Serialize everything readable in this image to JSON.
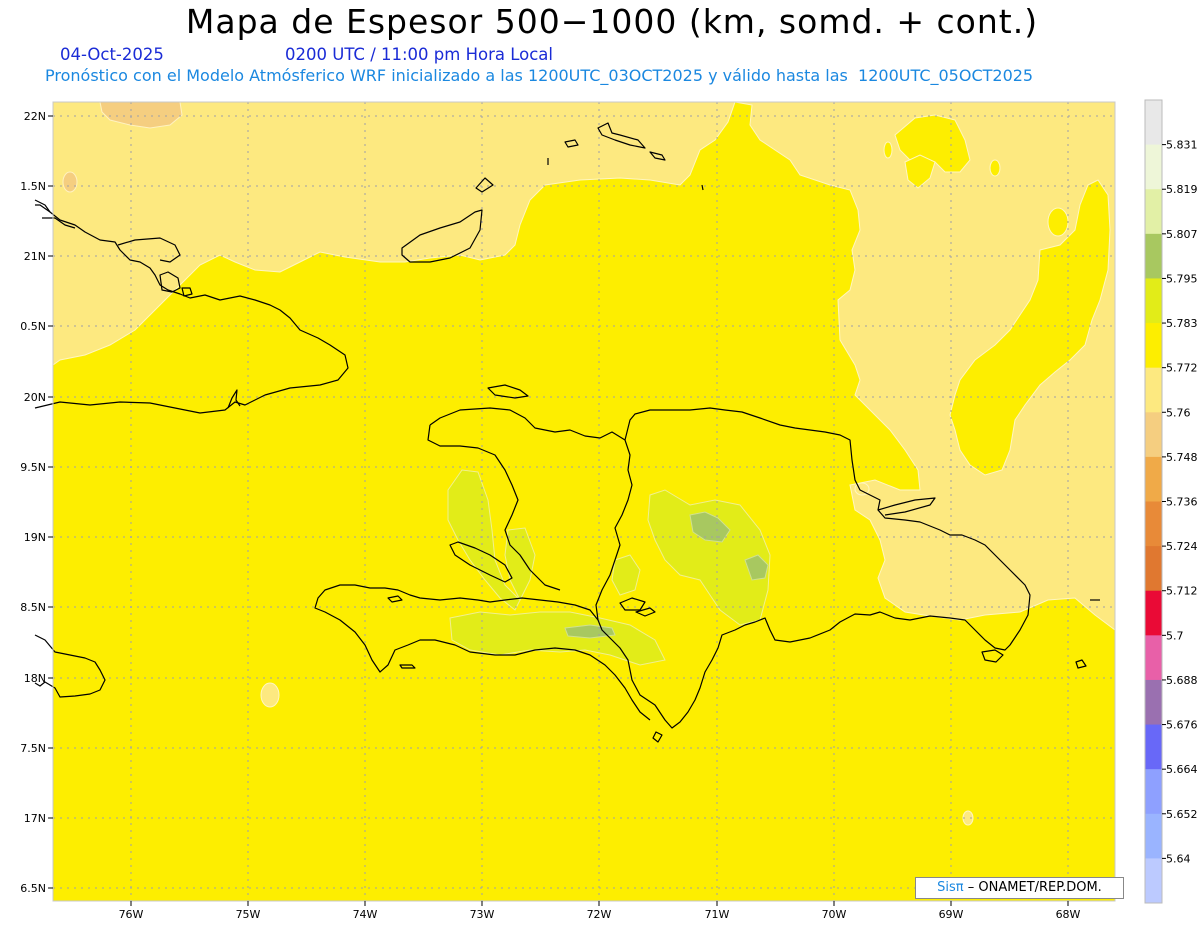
{
  "header": {
    "title": "Mapa de Espesor 500−1000 (km, somd. + cont.)",
    "date": "04-Oct-2025",
    "time": "0200 UTC / 11:00 pm Hora Local",
    "model_line": "Pronóstico con el Modelo Atmósferico WRF inicializado a las 1200UTC_03OCT2025 y válido hasta las  1200UTC_05OCT2025"
  },
  "axes": {
    "lat_labels": [
      "22N",
      "1.5N",
      "21N",
      "0.5N",
      "20N",
      "9.5N",
      "19N",
      "8.5N",
      "18N",
      "7.5N",
      "17N",
      "6.5N"
    ],
    "lon_labels": [
      "76W",
      "75W",
      "74W",
      "73W",
      "72W",
      "71W",
      "70W",
      "69W",
      "68W"
    ]
  },
  "colorbar": {
    "labels": [
      "5.831",
      "5.819",
      "5.807",
      "5.795",
      "5.783",
      "5.772",
      "5.76",
      "5.748",
      "5.736",
      "5.724",
      "5.712",
      "5.7",
      "5.688",
      "5.676",
      "5.664",
      "5.652",
      "5.64"
    ],
    "colors": [
      "#e8e8e8",
      "#eef6d8",
      "#e2f0a6",
      "#a8c860",
      "#e2ec18",
      "#fdee00",
      "#fde980",
      "#f5ce80",
      "#f0aa48",
      "#e88a38",
      "#e07830",
      "#ea0a36",
      "#e860a8",
      "#9a70b0",
      "#6868f8",
      "#8ea0ff",
      "#9ab4ff",
      "#bccaff"
    ]
  },
  "map": {
    "base_color": "#fdee00",
    "warm_color": "#fde980",
    "warmer_color": "#f5ce80",
    "cool_color": "#e2ec18",
    "cooler_color": "#a8c860"
  },
  "credit": {
    "brand": "Sisπ",
    "text": "– ONAMET/REP.DOM."
  }
}
